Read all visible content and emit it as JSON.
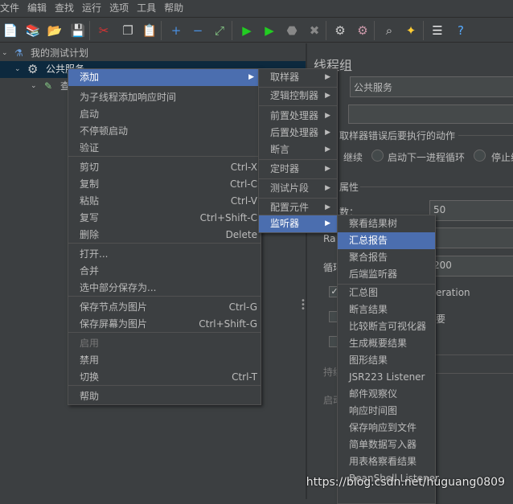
{
  "menubar": [
    "文件",
    "编辑",
    "查找",
    "运行",
    "选项",
    "工具",
    "帮助"
  ],
  "toolbar": {
    "icons": [
      "new-icon",
      "templates-icon",
      "open-icon",
      "save-icon",
      "cut-icon",
      "copy-icon",
      "paste-icon",
      "expand-icon",
      "collapse-icon",
      "toggle-icon",
      "start-icon",
      "start-no-pause-icon",
      "stop-icon",
      "shutdown-icon",
      "clear-icon",
      "clear-all-icon",
      "search-icon",
      "reset-search-icon",
      "function-helper-icon",
      "help-icon"
    ]
  },
  "tree": {
    "root": "我的测试计划",
    "selected": "公共服务",
    "child": "查"
  },
  "right": {
    "title": "线程组",
    "name_value": "公共服务",
    "comment_value": "",
    "error_action_title": "取样器错误后要执行的动作",
    "radios": [
      "继续",
      "启动下一进程循环",
      "停止线"
    ],
    "props_title": "属性",
    "threads_label": "数：",
    "threads_value": "50",
    "rampup_label": "Ra",
    "loop_label": "循环",
    "loop_value": "200",
    "same_user": "eration",
    "delay_label": "要",
    "duration_label": "持续",
    "startup_label": "启动"
  },
  "context_menu": {
    "items": [
      {
        "label": "添加",
        "arrow": true
      },
      {
        "label": "为子线程添加响应时间"
      },
      {
        "label": "启动"
      },
      {
        "label": "不停顿启动"
      },
      {
        "label": "验证"
      },
      {
        "label": "剪切",
        "shortcut": "Ctrl-X"
      },
      {
        "label": "复制",
        "shortcut": "Ctrl-C"
      },
      {
        "label": "粘贴",
        "shortcut": "Ctrl-V"
      },
      {
        "label": "复写",
        "shortcut": "Ctrl+Shift-C"
      },
      {
        "label": "删除",
        "shortcut": "Delete"
      },
      {
        "label": "打开..."
      },
      {
        "label": "合并"
      },
      {
        "label": "选中部分保存为..."
      },
      {
        "label": "保存节点为图片",
        "shortcut": "Ctrl-G"
      },
      {
        "label": "保存屏幕为图片",
        "shortcut": "Ctrl+Shift-G"
      },
      {
        "label": "启用",
        "disabled": true
      },
      {
        "label": "禁用"
      },
      {
        "label": "切换",
        "shortcut": "Ctrl-T"
      },
      {
        "label": "帮助"
      }
    ]
  },
  "add_submenu": [
    "取样器",
    "逻辑控制器",
    "前置处理器",
    "后置处理器",
    "断言",
    "定时器",
    "测试片段",
    "配置元件",
    "监听器"
  ],
  "listener_submenu": [
    "察看结果树",
    "汇总报告",
    "聚合报告",
    "后端监听器",
    "汇总图",
    "断言结果",
    "比较断言可视化器",
    "生成概要结果",
    "图形结果",
    "JSR223 Listener",
    "邮件观察仪",
    "响应时间图",
    "保存响应到文件",
    "简单数据写入器",
    "用表格察看结果",
    "BeanShell Listener"
  ],
  "watermark": "https://blog.csdn.net/huguang0809",
  "colors": {
    "bg": "#3c3f41",
    "highlight": "#4b6eaf",
    "tree_selected": "#0d293e"
  }
}
